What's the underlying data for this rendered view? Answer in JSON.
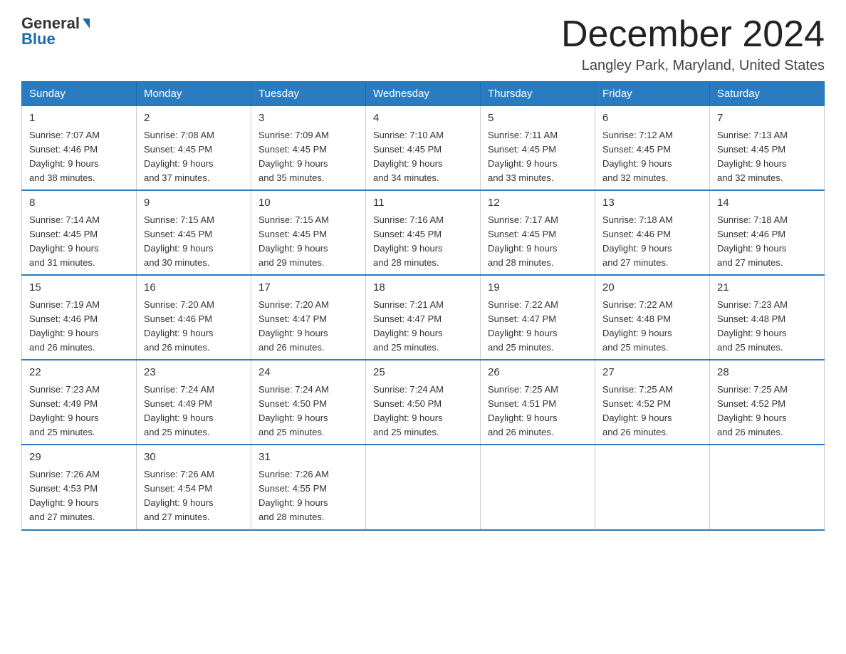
{
  "logo": {
    "part1": "General",
    "part2": "Blue"
  },
  "header": {
    "title": "December 2024",
    "subtitle": "Langley Park, Maryland, United States"
  },
  "weekdays": [
    "Sunday",
    "Monday",
    "Tuesday",
    "Wednesday",
    "Thursday",
    "Friday",
    "Saturday"
  ],
  "weeks": [
    [
      {
        "day": "1",
        "sunrise": "7:07 AM",
        "sunset": "4:46 PM",
        "daylight": "9 hours and 38 minutes."
      },
      {
        "day": "2",
        "sunrise": "7:08 AM",
        "sunset": "4:45 PM",
        "daylight": "9 hours and 37 minutes."
      },
      {
        "day": "3",
        "sunrise": "7:09 AM",
        "sunset": "4:45 PM",
        "daylight": "9 hours and 35 minutes."
      },
      {
        "day": "4",
        "sunrise": "7:10 AM",
        "sunset": "4:45 PM",
        "daylight": "9 hours and 34 minutes."
      },
      {
        "day": "5",
        "sunrise": "7:11 AM",
        "sunset": "4:45 PM",
        "daylight": "9 hours and 33 minutes."
      },
      {
        "day": "6",
        "sunrise": "7:12 AM",
        "sunset": "4:45 PM",
        "daylight": "9 hours and 32 minutes."
      },
      {
        "day": "7",
        "sunrise": "7:13 AM",
        "sunset": "4:45 PM",
        "daylight": "9 hours and 32 minutes."
      }
    ],
    [
      {
        "day": "8",
        "sunrise": "7:14 AM",
        "sunset": "4:45 PM",
        "daylight": "9 hours and 31 minutes."
      },
      {
        "day": "9",
        "sunrise": "7:15 AM",
        "sunset": "4:45 PM",
        "daylight": "9 hours and 30 minutes."
      },
      {
        "day": "10",
        "sunrise": "7:15 AM",
        "sunset": "4:45 PM",
        "daylight": "9 hours and 29 minutes."
      },
      {
        "day": "11",
        "sunrise": "7:16 AM",
        "sunset": "4:45 PM",
        "daylight": "9 hours and 28 minutes."
      },
      {
        "day": "12",
        "sunrise": "7:17 AM",
        "sunset": "4:45 PM",
        "daylight": "9 hours and 28 minutes."
      },
      {
        "day": "13",
        "sunrise": "7:18 AM",
        "sunset": "4:46 PM",
        "daylight": "9 hours and 27 minutes."
      },
      {
        "day": "14",
        "sunrise": "7:18 AM",
        "sunset": "4:46 PM",
        "daylight": "9 hours and 27 minutes."
      }
    ],
    [
      {
        "day": "15",
        "sunrise": "7:19 AM",
        "sunset": "4:46 PM",
        "daylight": "9 hours and 26 minutes."
      },
      {
        "day": "16",
        "sunrise": "7:20 AM",
        "sunset": "4:46 PM",
        "daylight": "9 hours and 26 minutes."
      },
      {
        "day": "17",
        "sunrise": "7:20 AM",
        "sunset": "4:47 PM",
        "daylight": "9 hours and 26 minutes."
      },
      {
        "day": "18",
        "sunrise": "7:21 AM",
        "sunset": "4:47 PM",
        "daylight": "9 hours and 25 minutes."
      },
      {
        "day": "19",
        "sunrise": "7:22 AM",
        "sunset": "4:47 PM",
        "daylight": "9 hours and 25 minutes."
      },
      {
        "day": "20",
        "sunrise": "7:22 AM",
        "sunset": "4:48 PM",
        "daylight": "9 hours and 25 minutes."
      },
      {
        "day": "21",
        "sunrise": "7:23 AM",
        "sunset": "4:48 PM",
        "daylight": "9 hours and 25 minutes."
      }
    ],
    [
      {
        "day": "22",
        "sunrise": "7:23 AM",
        "sunset": "4:49 PM",
        "daylight": "9 hours and 25 minutes."
      },
      {
        "day": "23",
        "sunrise": "7:24 AM",
        "sunset": "4:49 PM",
        "daylight": "9 hours and 25 minutes."
      },
      {
        "day": "24",
        "sunrise": "7:24 AM",
        "sunset": "4:50 PM",
        "daylight": "9 hours and 25 minutes."
      },
      {
        "day": "25",
        "sunrise": "7:24 AM",
        "sunset": "4:50 PM",
        "daylight": "9 hours and 25 minutes."
      },
      {
        "day": "26",
        "sunrise": "7:25 AM",
        "sunset": "4:51 PM",
        "daylight": "9 hours and 26 minutes."
      },
      {
        "day": "27",
        "sunrise": "7:25 AM",
        "sunset": "4:52 PM",
        "daylight": "9 hours and 26 minutes."
      },
      {
        "day": "28",
        "sunrise": "7:25 AM",
        "sunset": "4:52 PM",
        "daylight": "9 hours and 26 minutes."
      }
    ],
    [
      {
        "day": "29",
        "sunrise": "7:26 AM",
        "sunset": "4:53 PM",
        "daylight": "9 hours and 27 minutes."
      },
      {
        "day": "30",
        "sunrise": "7:26 AM",
        "sunset": "4:54 PM",
        "daylight": "9 hours and 27 minutes."
      },
      {
        "day": "31",
        "sunrise": "7:26 AM",
        "sunset": "4:55 PM",
        "daylight": "9 hours and 28 minutes."
      },
      null,
      null,
      null,
      null
    ]
  ],
  "labels": {
    "sunrise": "Sunrise:",
    "sunset": "Sunset:",
    "daylight": "Daylight:"
  }
}
